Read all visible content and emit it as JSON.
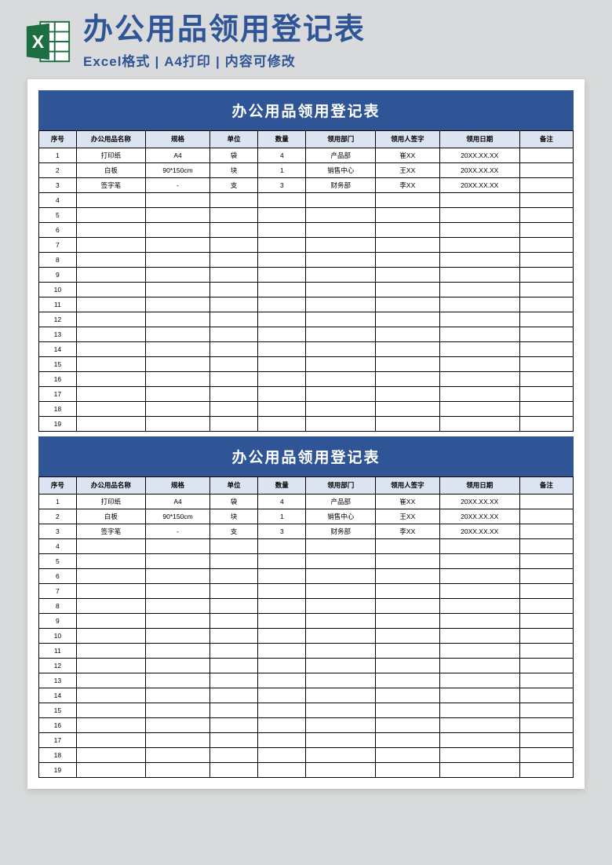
{
  "banner": {
    "title": "办公用品领用登记表",
    "sub_parts": [
      "Excel格式",
      "A4打印",
      "内容可修改"
    ]
  },
  "block_title": "办公用品领用登记表",
  "columns": [
    "序号",
    "办公用品名称",
    "规格",
    "单位",
    "数量",
    "领用部门",
    "领用人签字",
    "领用日期",
    "备注"
  ],
  "rows": [
    {
      "seq": "1",
      "name": "打印纸",
      "spec": "A4",
      "unit": "袋",
      "qty": "4",
      "dept": "产品部",
      "sig": "崔XX",
      "date": "20XX.XX.XX",
      "note": ""
    },
    {
      "seq": "2",
      "name": "白板",
      "spec": "90*150cm",
      "unit": "块",
      "qty": "1",
      "dept": "销售中心",
      "sig": "王XX",
      "date": "20XX.XX.XX",
      "note": ""
    },
    {
      "seq": "3",
      "name": "签字笔",
      "spec": "-",
      "unit": "支",
      "qty": "3",
      "dept": "财务部",
      "sig": "李XX",
      "date": "20XX.XX.XX",
      "note": ""
    },
    {
      "seq": "4",
      "name": "",
      "spec": "",
      "unit": "",
      "qty": "",
      "dept": "",
      "sig": "",
      "date": "",
      "note": ""
    },
    {
      "seq": "5",
      "name": "",
      "spec": "",
      "unit": "",
      "qty": "",
      "dept": "",
      "sig": "",
      "date": "",
      "note": ""
    },
    {
      "seq": "6",
      "name": "",
      "spec": "",
      "unit": "",
      "qty": "",
      "dept": "",
      "sig": "",
      "date": "",
      "note": ""
    },
    {
      "seq": "7",
      "name": "",
      "spec": "",
      "unit": "",
      "qty": "",
      "dept": "",
      "sig": "",
      "date": "",
      "note": ""
    },
    {
      "seq": "8",
      "name": "",
      "spec": "",
      "unit": "",
      "qty": "",
      "dept": "",
      "sig": "",
      "date": "",
      "note": ""
    },
    {
      "seq": "9",
      "name": "",
      "spec": "",
      "unit": "",
      "qty": "",
      "dept": "",
      "sig": "",
      "date": "",
      "note": ""
    },
    {
      "seq": "10",
      "name": "",
      "spec": "",
      "unit": "",
      "qty": "",
      "dept": "",
      "sig": "",
      "date": "",
      "note": ""
    },
    {
      "seq": "11",
      "name": "",
      "spec": "",
      "unit": "",
      "qty": "",
      "dept": "",
      "sig": "",
      "date": "",
      "note": ""
    },
    {
      "seq": "12",
      "name": "",
      "spec": "",
      "unit": "",
      "qty": "",
      "dept": "",
      "sig": "",
      "date": "",
      "note": ""
    },
    {
      "seq": "13",
      "name": "",
      "spec": "",
      "unit": "",
      "qty": "",
      "dept": "",
      "sig": "",
      "date": "",
      "note": ""
    },
    {
      "seq": "14",
      "name": "",
      "spec": "",
      "unit": "",
      "qty": "",
      "dept": "",
      "sig": "",
      "date": "",
      "note": ""
    },
    {
      "seq": "15",
      "name": "",
      "spec": "",
      "unit": "",
      "qty": "",
      "dept": "",
      "sig": "",
      "date": "",
      "note": ""
    },
    {
      "seq": "16",
      "name": "",
      "spec": "",
      "unit": "",
      "qty": "",
      "dept": "",
      "sig": "",
      "date": "",
      "note": ""
    },
    {
      "seq": "17",
      "name": "",
      "spec": "",
      "unit": "",
      "qty": "",
      "dept": "",
      "sig": "",
      "date": "",
      "note": ""
    },
    {
      "seq": "18",
      "name": "",
      "spec": "",
      "unit": "",
      "qty": "",
      "dept": "",
      "sig": "",
      "date": "",
      "note": ""
    },
    {
      "seq": "19",
      "name": "",
      "spec": "",
      "unit": "",
      "qty": "",
      "dept": "",
      "sig": "",
      "date": "",
      "note": ""
    }
  ]
}
